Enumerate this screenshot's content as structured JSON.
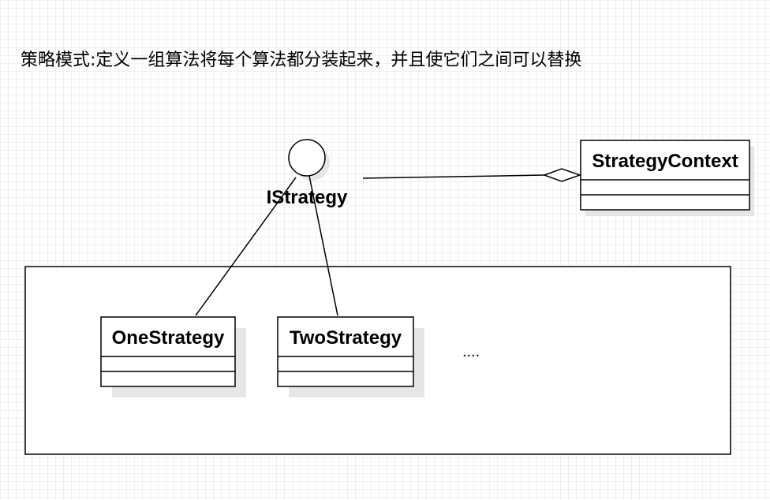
{
  "title": "策略模式:定义一组算法将每个算法都分装起来，并且使它们之间可以替换",
  "interface": {
    "name": "IStrategy"
  },
  "context_class": {
    "name": "StrategyContext"
  },
  "strategy_classes": [
    {
      "name": "OneStrategy"
    },
    {
      "name": "TwoStrategy"
    }
  ],
  "ellipsis": "....",
  "colors": {
    "line": "#000000",
    "fill": "#ffffff",
    "shadow": "#e6e6e6",
    "grid": "#f0f0f0"
  }
}
